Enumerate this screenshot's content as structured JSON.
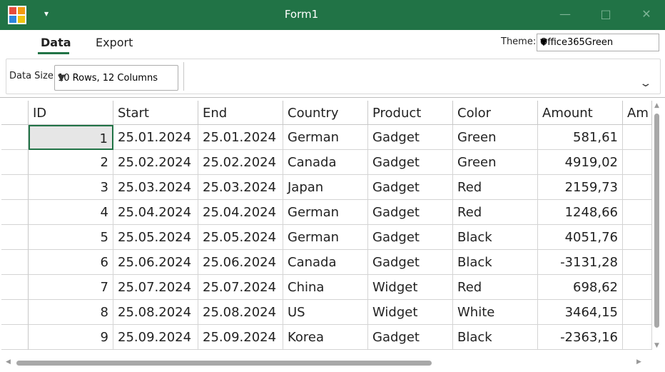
{
  "window": {
    "title": "Form1",
    "quick_access": "▾"
  },
  "tabs": [
    {
      "label": "Data"
    },
    {
      "label": "Export"
    }
  ],
  "theme": {
    "label": "Theme:",
    "value": "Office365Green"
  },
  "data_size": {
    "label": "Data Size",
    "value": "10 Rows, 12 Columns"
  },
  "colors": {
    "accent": "#217346"
  },
  "grid": {
    "columns": [
      "ID",
      "Start",
      "End",
      "Country",
      "Product",
      "Color",
      "Amount",
      "Am"
    ],
    "rows": [
      [
        "1",
        "25.01.2024",
        "25.01.2024",
        "German",
        "Gadget",
        "Green",
        "581,61"
      ],
      [
        "2",
        "25.02.2024",
        "25.02.2024",
        "Canada",
        "Gadget",
        "Green",
        "4919,02"
      ],
      [
        "3",
        "25.03.2024",
        "25.03.2024",
        "Japan",
        "Gadget",
        "Red",
        "2159,73"
      ],
      [
        "4",
        "25.04.2024",
        "25.04.2024",
        "German",
        "Gadget",
        "Red",
        "1248,66"
      ],
      [
        "5",
        "25.05.2024",
        "25.05.2024",
        "German",
        "Gadget",
        "Black",
        "4051,76"
      ],
      [
        "6",
        "25.06.2024",
        "25.06.2024",
        "Canada",
        "Gadget",
        "Black",
        "-3131,28"
      ],
      [
        "7",
        "25.07.2024",
        "25.07.2024",
        "China",
        "Widget",
        "Red",
        "698,62"
      ],
      [
        "8",
        "25.08.2024",
        "25.08.2024",
        "US",
        "Widget",
        "White",
        "3464,15"
      ],
      [
        "9",
        "25.09.2024",
        "25.09.2024",
        "Korea",
        "Gadget",
        "Black",
        "-2363,16"
      ]
    ]
  }
}
